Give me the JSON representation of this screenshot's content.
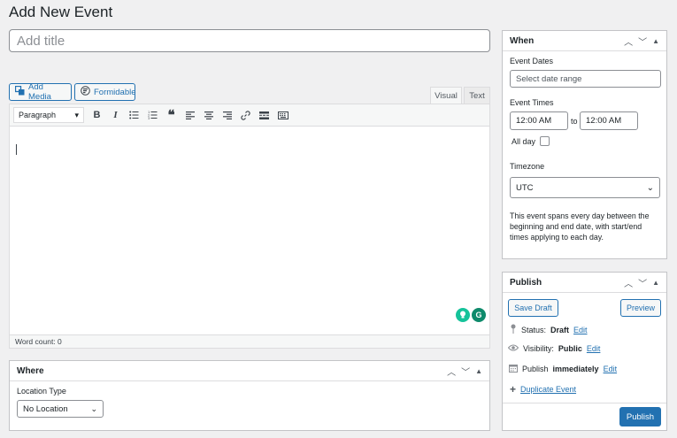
{
  "page": {
    "title": "Add New Event"
  },
  "title_field": {
    "placeholder": "Add title"
  },
  "media": {
    "add_media_label": "Add Media",
    "formidable_label": "Formidable"
  },
  "editor": {
    "tabs": {
      "visual": "Visual",
      "text": "Text"
    },
    "format_select": "Paragraph",
    "toolbar_icons": [
      "bold-icon",
      "italic-icon",
      "bulleted-list-icon",
      "numbered-list-icon",
      "blockquote-icon",
      "align-left-icon",
      "align-center-icon",
      "align-right-icon",
      "link-icon",
      "read-more-icon",
      "toolbar-toggle-icon"
    ],
    "word_count": "Word count: 0"
  },
  "where": {
    "title": "Where",
    "location_type_label": "Location Type",
    "location_type_value": "No Location"
  },
  "when": {
    "title": "When",
    "event_dates_label": "Event Dates",
    "date_placeholder": "Select date range",
    "event_times_label": "Event Times",
    "start_time": "12:00 AM",
    "to_label": "to",
    "end_time": "12:00 AM",
    "all_day_label": "All day",
    "timezone_label": "Timezone",
    "timezone_value": "UTC",
    "description": "This event spans every day between the beginning and end date, with start/end times applying to each day."
  },
  "publish": {
    "title": "Publish",
    "save_draft_label": "Save Draft",
    "preview_label": "Preview",
    "status_label": "Status:",
    "status_value": "Draft",
    "visibility_label": "Visibility:",
    "visibility_value": "Public",
    "publish_label": "Publish",
    "publish_value": "immediately",
    "edit_label": "Edit",
    "duplicate_label": "Duplicate Event",
    "publish_button": "Publish"
  },
  "colors": {
    "accent": "#2271b1",
    "grammarly_green": "#15c39a",
    "grammarly_dark": "#0e8a6b"
  }
}
